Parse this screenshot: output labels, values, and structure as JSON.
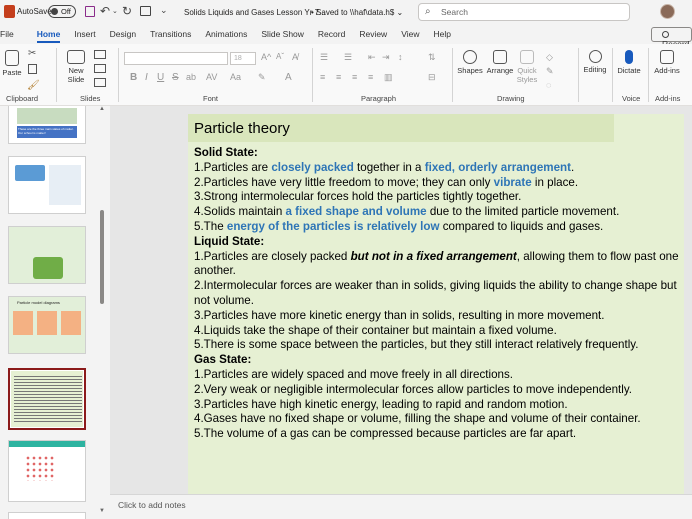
{
  "titlebar": {
    "autosave_label": "AutoSave",
    "autosave_state": "Off",
    "doc_title": "Solids Liquids and Gases Lesson Yr 7...",
    "saved_status": "Saved to \\\\haf\\data.h$",
    "search_placeholder": "Search"
  },
  "menu": {
    "tabs": [
      "File",
      "Home",
      "Insert",
      "Design",
      "Transitions",
      "Animations",
      "Slide Show",
      "Record",
      "Review",
      "View",
      "Help"
    ],
    "active_tab": "Home",
    "record_button": "Record"
  },
  "ribbon": {
    "groups": {
      "clipboard": "Clipboard",
      "slides": "Slides",
      "font": "Font",
      "paragraph": "Paragraph",
      "drawing": "Drawing",
      "voice": "Voice",
      "addins": "Add-ins"
    },
    "paste": "Paste",
    "new_slide": "New Slide",
    "shapes": "Shapes",
    "arrange": "Arrange",
    "quick_styles": "Quick Styles",
    "editing": "Editing",
    "dictate": "Dictate",
    "addins_btn": "Add-ins",
    "font_size": "18"
  },
  "slide": {
    "title": "Particle theory",
    "solid_heading": "Solid State:",
    "solid_1a": "1.Particles are ",
    "solid_1b": "closely packed",
    "solid_1c": " together in a ",
    "solid_1d": "fixed, orderly arrangement",
    "solid_1e": ".",
    "solid_2a": "2.Particles have very little freedom to move; they can only ",
    "solid_2b": "vibrate",
    "solid_2c": " in place.",
    "solid_3": "3.Strong intermolecular forces hold the particles tightly together.",
    "solid_4a": "4.Solids maintain ",
    "solid_4b": "a fixed shape and volume",
    "solid_4c": " due to the limited particle movement.",
    "solid_5a": "5.The ",
    "solid_5b": "energy of the particles is relatively low",
    "solid_5c": " compared to liquids and gases.",
    "liquid_heading": "Liquid State:",
    "liquid_1a": "1.Particles are closely packed ",
    "liquid_1b": "but not in a fixed arrangement",
    "liquid_1c": ", allowing them to flow past one another.",
    "liquid_2": "2.Intermolecular forces are weaker than in solids, giving liquids the ability to change shape but not volume.",
    "liquid_3": "3.Particles have more kinetic energy than in solids, resulting in more movement.",
    "liquid_4": "4.Liquids take the shape of their container but maintain a fixed volume.",
    "liquid_5": "5.There is some space between the particles, but they still interact relatively frequently.",
    "gas_heading": "Gas State:",
    "gas_1": "1.Particles are widely spaced and move freely in all directions.",
    "gas_2": "2.Very weak or negligible intermolecular forces allow particles to move independently.",
    "gas_3": "3.Particles have high kinetic energy, leading to rapid and random motion.",
    "gas_4": "4.Gases have no fixed shape or volume, filling the shape and volume of their container.",
    "gas_5": "5.The volume of a gas can be compressed because particles are far apart."
  },
  "thumbnails": {
    "t1_text": "These are the three main states of matter. Our school is matter!",
    "t4_title": "Particle model diagrams"
  },
  "notes": {
    "placeholder": "Click to add notes"
  }
}
